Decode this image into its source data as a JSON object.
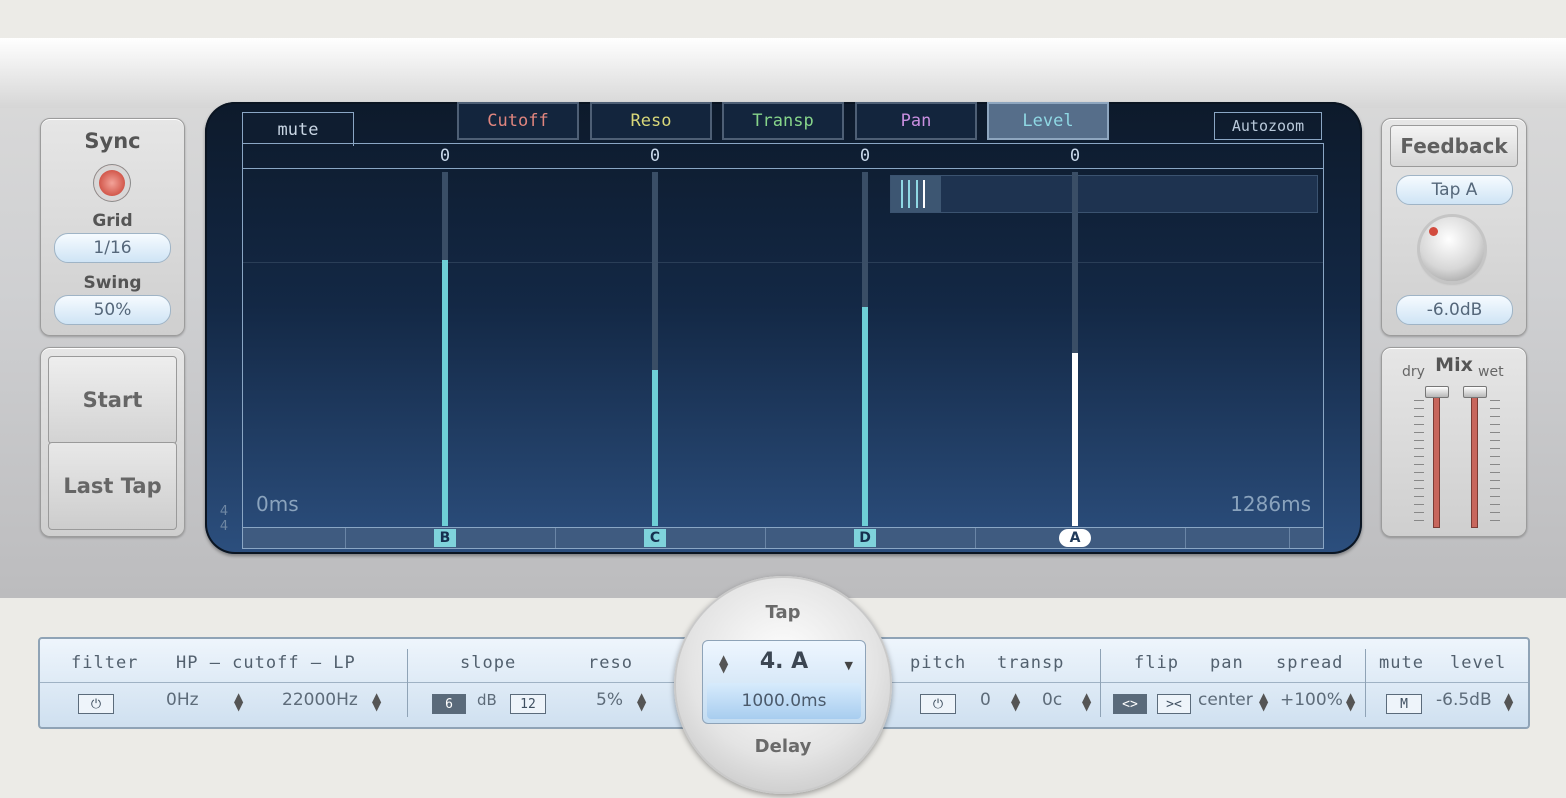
{
  "left_panel": {
    "sync_title": "Sync",
    "grid_title": "Grid",
    "grid_value": "1/16",
    "swing_title": "Swing",
    "swing_value": "50%",
    "start_label": "Start",
    "last_tap_label": "Last Tap"
  },
  "display": {
    "mute_tab": "mute",
    "modes": [
      "Cutoff",
      "Reso",
      "Transp",
      "Pan",
      "Level"
    ],
    "active_mode": "Level",
    "mode_colors": {
      "Cutoff": "#e0857e",
      "Reso": "#d8d77a",
      "Transp": "#86d48a",
      "Pan": "#c98fe0",
      "Level": "#8fd8e4"
    },
    "autozoom_label": "Autozoom",
    "start_time": "0ms",
    "end_time": "1286ms",
    "time_sig_top": "4",
    "time_sig_bottom": "4",
    "taps": [
      {
        "label": "B",
        "value": "0",
        "level": 0.75
      },
      {
        "label": "C",
        "value": "0",
        "level": 0.44
      },
      {
        "label": "D",
        "value": "0",
        "level": 0.62
      },
      {
        "label": "A",
        "value": "0",
        "level": 0.49,
        "selected": true
      }
    ]
  },
  "right_panel": {
    "feedback_label": "Feedback",
    "feedback_tap": "Tap A",
    "feedback_value": "-6.0dB",
    "mix_title": "Mix",
    "dry_label": "dry",
    "wet_label": "wet"
  },
  "bottom": {
    "filter_label": "filter",
    "hp_cutoff_lp_label": "HP – cutoff – LP",
    "hp_value": "0Hz",
    "lp_value": "22000Hz",
    "slope_label": "slope",
    "slope_6": "6",
    "slope_db": "dB",
    "slope_12": "12",
    "reso_label": "reso",
    "reso_value": "5%",
    "tap_title": "Tap",
    "tap_selected": "4. A",
    "delay_value": "1000.0ms",
    "delay_title": "Delay",
    "pitch_label": "pitch",
    "transp_label": "transp",
    "transp_semi": "0",
    "transp_cent": "0c",
    "flip_label": "flip",
    "pan_label": "pan",
    "spread_label": "spread",
    "pan_value": "center",
    "spread_value": "+100%",
    "mute_label": "mute",
    "level_label": "level",
    "mute_button": "M",
    "level_value": "-6.5dB"
  }
}
